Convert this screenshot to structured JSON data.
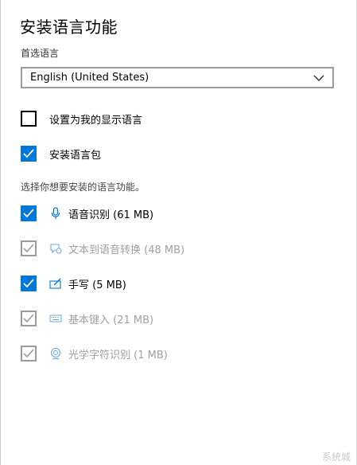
{
  "title": "安装语言功能",
  "preferred_language": {
    "label": "首选语言",
    "selected": "English (United States)"
  },
  "options": [
    {
      "label": "设置为我的显示语言",
      "checked": false
    },
    {
      "label": "安装语言包",
      "checked": true
    }
  ],
  "features_description": "选择你想要安装的语言功能。",
  "features": [
    {
      "label": "语音识别 (61 MB)",
      "icon": "microphone-icon",
      "checked": true,
      "enabled": true
    },
    {
      "label": "文本到语音转换 (48 MB)",
      "icon": "text-to-speech-icon",
      "checked": true,
      "enabled": false
    },
    {
      "label": "手写 (5 MB)",
      "icon": "handwriting-icon",
      "checked": true,
      "enabled": true
    },
    {
      "label": "基本键入 (21 MB)",
      "icon": "keyboard-icon",
      "checked": true,
      "enabled": false
    },
    {
      "label": "光学字符识别 (1 MB)",
      "icon": "ocr-camera-icon",
      "checked": true,
      "enabled": false
    }
  ],
  "watermark": "系统城",
  "colors": {
    "accent": "#0078d7",
    "disabled": "#a0a0a0"
  }
}
